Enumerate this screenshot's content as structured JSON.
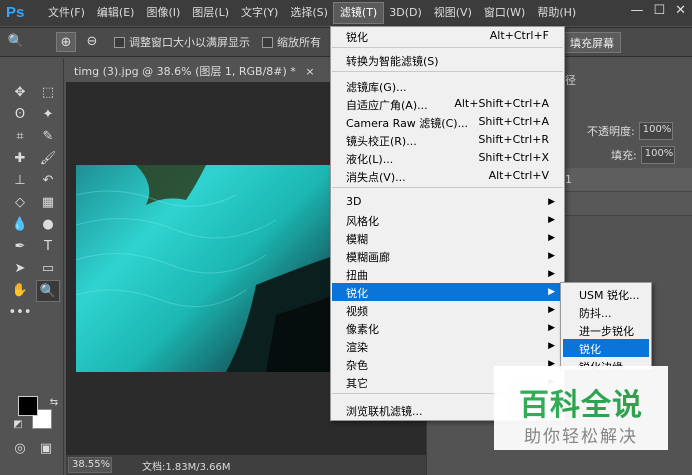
{
  "app": {
    "logo": "Ps"
  },
  "menubar": [
    {
      "label": "文件(F)"
    },
    {
      "label": "编辑(E)"
    },
    {
      "label": "图像(I)"
    },
    {
      "label": "图层(L)"
    },
    {
      "label": "文字(Y)"
    },
    {
      "label": "选择(S)"
    },
    {
      "label": "滤镜(T)"
    },
    {
      "label": "3D(D)"
    },
    {
      "label": "视图(V)"
    },
    {
      "label": "窗口(W)"
    },
    {
      "label": "帮助(H)"
    }
  ],
  "window_controls": {
    "minimize": "—",
    "maximize": "☐",
    "close": "✕"
  },
  "options": {
    "resize_windows": "调整窗口大小以满屏显示",
    "zoom_all": "缩放所有",
    "fill_screen": "填充屏幕"
  },
  "document": {
    "tab": "timg (3).jpg @ 38.6% (图层 1, RGB/8#) *",
    "tab_close": "×",
    "zoom": "38.55%",
    "doc_size": "文档:1.83M/3.66M"
  },
  "right_panel": {
    "tab_partial": "径",
    "opacity_label": "不透明度:",
    "opacity_value": "100%",
    "fill_label": "填充:",
    "fill_value": "100%",
    "layer_number": "1"
  },
  "filter_menu": {
    "items": [
      {
        "label": "锐化",
        "shortcut": "Alt+Ctrl+F"
      },
      {
        "label": "转换为智能滤镜(S)",
        "shortcut": ""
      },
      {
        "label": "滤镜库(G)...",
        "shortcut": ""
      },
      {
        "label": "自适应广角(A)...",
        "shortcut": "Alt+Shift+Ctrl+A"
      },
      {
        "label": "Camera Raw 滤镜(C)...",
        "shortcut": "Shift+Ctrl+A"
      },
      {
        "label": "镜头校正(R)...",
        "shortcut": "Shift+Ctrl+R"
      },
      {
        "label": "液化(L)...",
        "shortcut": "Shift+Ctrl+X"
      },
      {
        "label": "消失点(V)...",
        "shortcut": "Alt+Ctrl+V"
      },
      {
        "label": "3D"
      },
      {
        "label": "风格化"
      },
      {
        "label": "模糊"
      },
      {
        "label": "模糊画廊"
      },
      {
        "label": "扭曲"
      },
      {
        "label": "锐化"
      },
      {
        "label": "视频"
      },
      {
        "label": "像素化"
      },
      {
        "label": "渲染"
      },
      {
        "label": "杂色"
      },
      {
        "label": "其它"
      },
      {
        "label": "浏览联机滤镜..."
      }
    ],
    "submenu_arrow": "▶"
  },
  "sharpen_submenu": [
    {
      "label": "USM 锐化..."
    },
    {
      "label": "防抖..."
    },
    {
      "label": "进一步锐化"
    },
    {
      "label": "锐化"
    },
    {
      "label": "锐化边缘"
    }
  ],
  "watermark": {
    "title": "百科全说",
    "subtitle": "助你轻松解决"
  },
  "icons": {
    "zoom": "🔍",
    "zoom_in": "⊕",
    "zoom_out": "⊖",
    "move": "✥",
    "marquee": "⬚",
    "lasso": "ʘ",
    "magic_wand": "✦",
    "crop": "⌗",
    "eyedropper": "✎",
    "healing": "✚",
    "brush": "🖌",
    "stamp": "⊥",
    "history_brush": "↶",
    "eraser": "◇",
    "gradient": "▦",
    "blur": "💧",
    "dodge": "●",
    "pen": "✒",
    "type": "T",
    "path_select": "➤",
    "shape": "▭",
    "hand": "✋",
    "zoom_tool": "🔍",
    "more": "•••",
    "swap": "⇆",
    "default_colors": "◩",
    "quickmask": "◎",
    "screen_mode": "▣"
  }
}
